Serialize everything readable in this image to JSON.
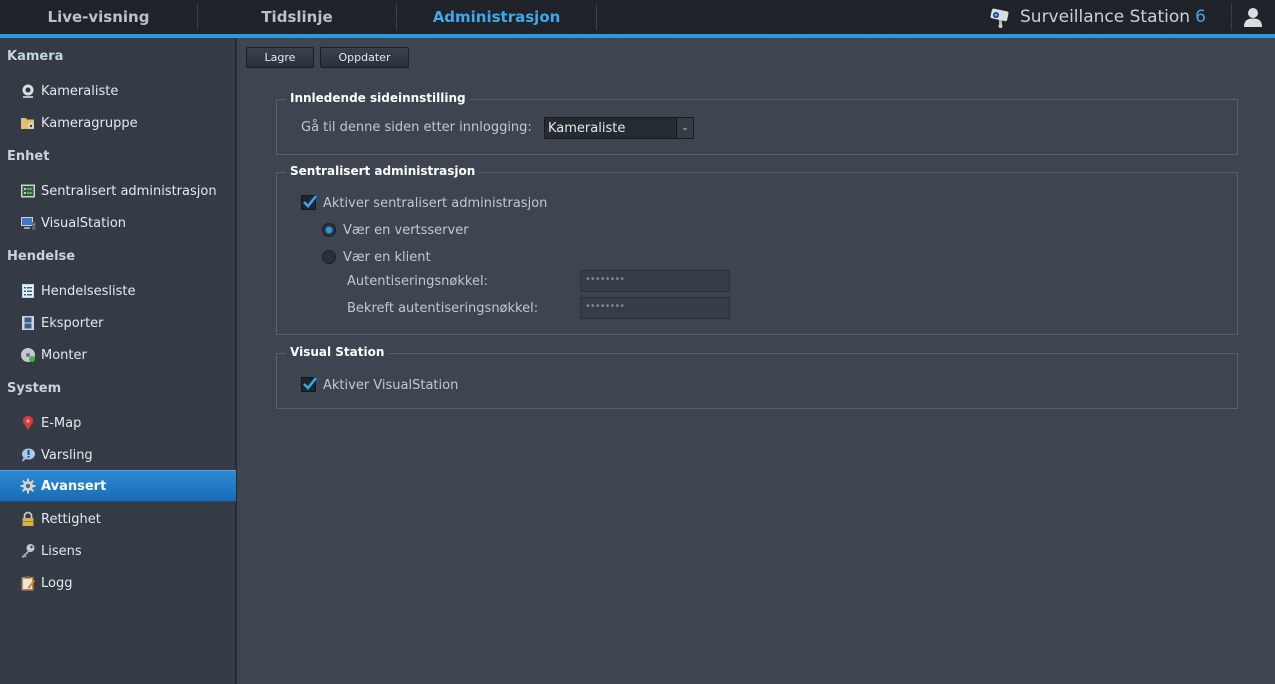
{
  "topnav": {
    "tabs": [
      {
        "label": "Live-visning",
        "active": false
      },
      {
        "label": "Tidslinje",
        "active": false
      },
      {
        "label": "Administrasjon",
        "active": true
      }
    ],
    "brand": {
      "name": "Surveillance Station",
      "version": "6"
    },
    "user_icon": "user-icon"
  },
  "sidebar": {
    "sections": [
      {
        "title": "Kamera",
        "items": [
          {
            "label": "Kameraliste",
            "icon": "webcam-icon"
          },
          {
            "label": "Kameragruppe",
            "icon": "camera-folder-icon"
          }
        ]
      },
      {
        "title": "Enhet",
        "items": [
          {
            "label": "Sentralisert administrasjon",
            "icon": "central-admin-icon"
          },
          {
            "label": "VisualStation",
            "icon": "monitor-icon"
          }
        ]
      },
      {
        "title": "Hendelse",
        "items": [
          {
            "label": "Hendelsesliste",
            "icon": "list-document-icon"
          },
          {
            "label": "Eksporter",
            "icon": "film-icon"
          },
          {
            "label": "Monter",
            "icon": "disc-mount-icon"
          }
        ]
      },
      {
        "title": "System",
        "items": [
          {
            "label": "E-Map",
            "icon": "map-pin-icon"
          },
          {
            "label": "Varsling",
            "icon": "notification-bubble-icon"
          },
          {
            "label": "Avansert",
            "icon": "gear-icon",
            "active": true
          },
          {
            "label": "Rettighet",
            "icon": "lock-icon"
          },
          {
            "label": "Lisens",
            "icon": "key-icon"
          },
          {
            "label": "Logg",
            "icon": "clipboard-log-icon"
          }
        ]
      }
    ]
  },
  "toolbar": {
    "save_label": "Lagre",
    "refresh_label": "Oppdater"
  },
  "sections": {
    "initial_page": {
      "title": "Innledende sideinnstilling",
      "field_label": "Gå til denne siden etter innlogging:",
      "selected": "Kameraliste"
    },
    "central_admin": {
      "title": "Sentralisert administrasjon",
      "enable_label": "Aktiver sentralisert administrasjon",
      "enable_checked": true,
      "radio_host_label": "Vær en vertsserver",
      "radio_client_label": "Vær en klient",
      "selected_mode": "host",
      "auth_key_label": "Autentiseringsnøkkel:",
      "auth_key_value": "••••••••",
      "confirm_key_label": "Bekreft autentiseringsnøkkel:",
      "confirm_key_value": "••••••••"
    },
    "visual_station": {
      "title": "Visual Station",
      "enable_label": "Aktiver VisualStation",
      "enable_checked": true
    }
  }
}
